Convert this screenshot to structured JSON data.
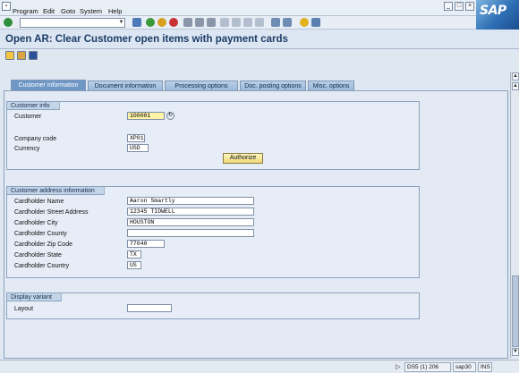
{
  "menubar": {
    "items": [
      "Program",
      "Edit",
      "Goto",
      "System",
      "Help"
    ]
  },
  "title": "Open AR: Clear Customer open items with payment cards",
  "tabs": [
    "Customer information",
    "Document information",
    "Processing options",
    "Doc. posting options",
    "Misc. options"
  ],
  "customer_info": {
    "group_title": "Customer info",
    "customer_label": "Customer",
    "customer_value": "100001",
    "company_code_label": "Company code",
    "company_code_value": "XP01",
    "currency_label": "Currency",
    "currency_value": "USD",
    "authorize_label": "Authorize"
  },
  "address": {
    "group_title": "Customer address information",
    "rows": [
      {
        "label": "Cardholder Name",
        "value": "Aaron Smartly"
      },
      {
        "label": "Cardholder Street Address",
        "value": "12345 TIDWELL"
      },
      {
        "label": "Cardholder City",
        "value": "HOUSTON"
      },
      {
        "label": "Cardholder County",
        "value": ""
      },
      {
        "label": "Cardholder Zip Code",
        "value": "77040"
      },
      {
        "label": "Cardholder State",
        "value": "TX"
      },
      {
        "label": "Cardholder Country",
        "value": "US"
      }
    ]
  },
  "display_variant": {
    "group_title": "Display variant",
    "layout_label": "Layout",
    "layout_value": ""
  },
  "status": {
    "system": "DS5 (1) 206",
    "server": "sap30",
    "mode": "INS"
  },
  "colors": {
    "title_text": "#1c3c66",
    "required_field": "#fff3a8",
    "active_tab": "#6f97c6"
  }
}
